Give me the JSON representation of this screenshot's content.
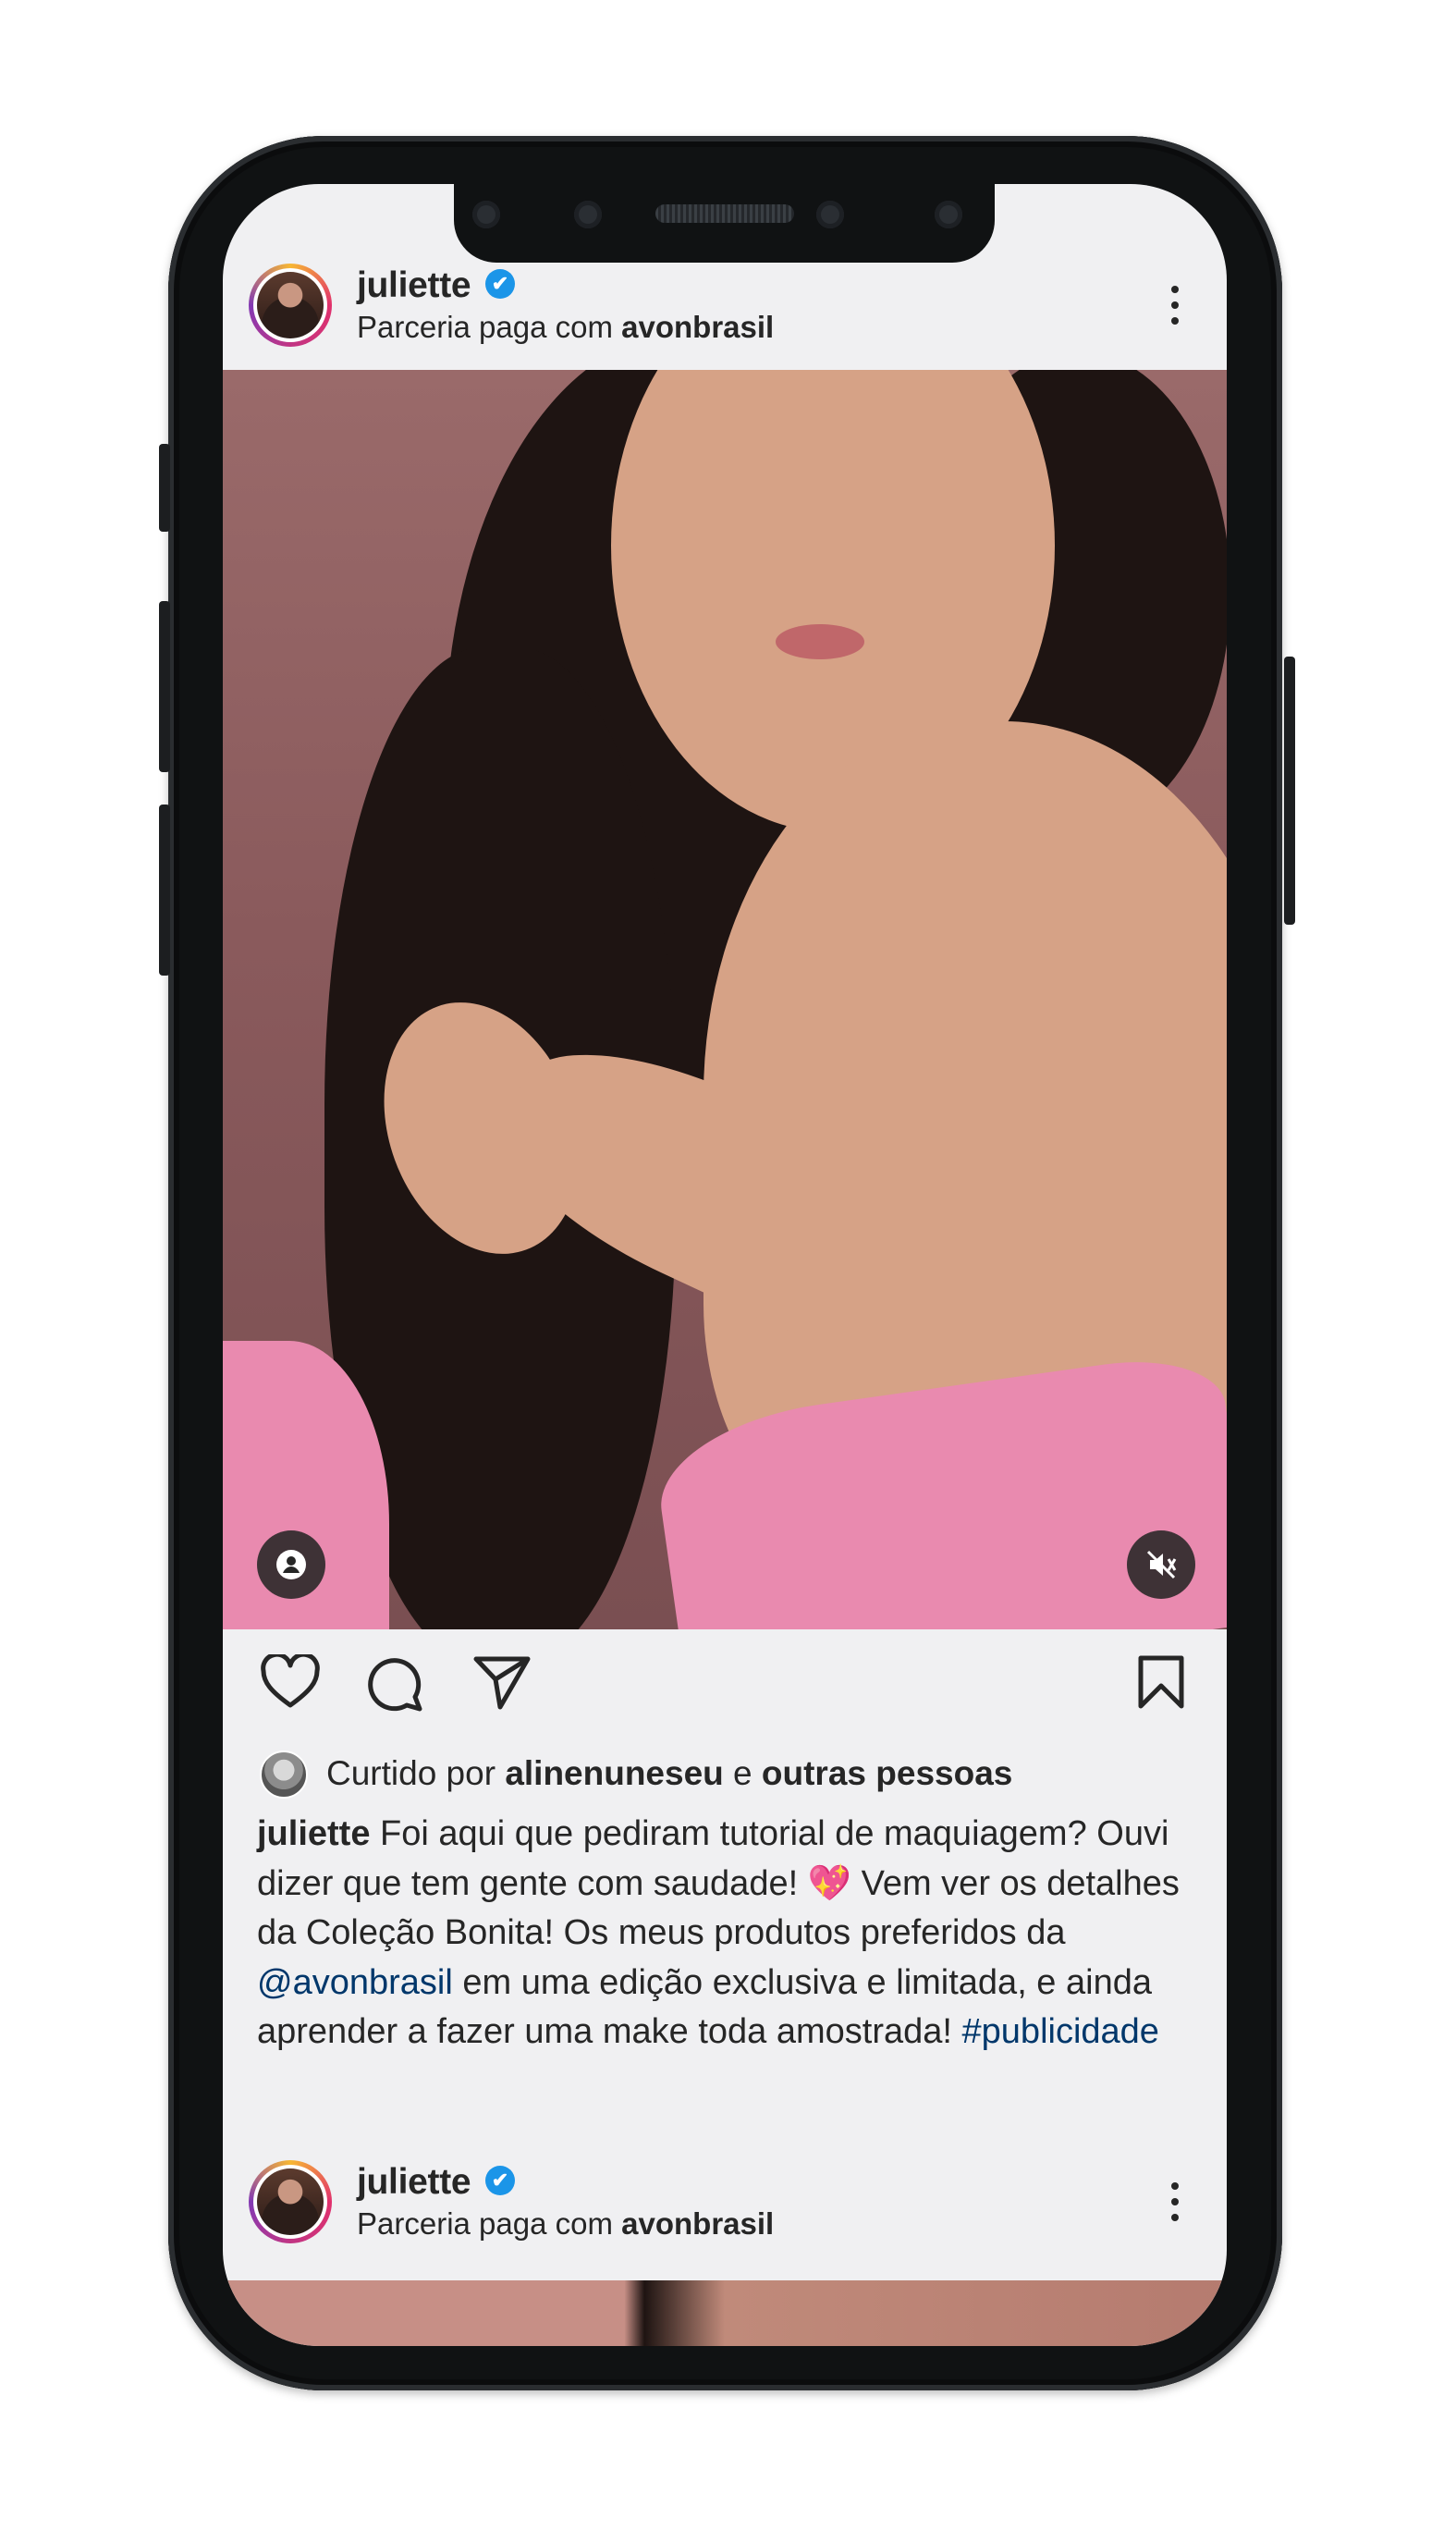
{
  "post": {
    "username": "juliette",
    "verified_icon": "✔",
    "partnership_prefix": "Parceria paga com ",
    "partner_name": "avonbrasil",
    "likes_prefix": "Curtido por ",
    "liked_by_user": "alinenuneseu",
    "likes_connector": " e ",
    "likes_others": "outras pessoas",
    "caption_user": "juliette",
    "caption_part1": " Foi aqui que pediram tutorial de maquiagem? Ouvi dizer que tem gente com saudade! ",
    "caption_emoji": "💖",
    "caption_part2": " Vem ver os detalhes da Coleção Bonita! Os meus produtos preferidos da ",
    "caption_mention": "@avonbrasil",
    "caption_part3": " em uma edição exclusiva e limitada, e ainda aprender a fazer uma make toda amostrada! ",
    "caption_hashtag": "#publicidade"
  },
  "next_post": {
    "username": "juliette",
    "partnership_prefix": "Parceria paga com ",
    "partner_name": "avonbrasil"
  },
  "icons": {
    "more": "more-options-icon",
    "tagged_user": "user-tag-icon",
    "mute": "sound-off-icon",
    "like": "heart-icon",
    "comment": "comment-icon",
    "share": "share-icon",
    "save": "bookmark-icon"
  },
  "colors": {
    "screen_bg": "#f0f0f2",
    "verified": "#1b95e8",
    "link": "#00376b",
    "text": "#262626"
  }
}
